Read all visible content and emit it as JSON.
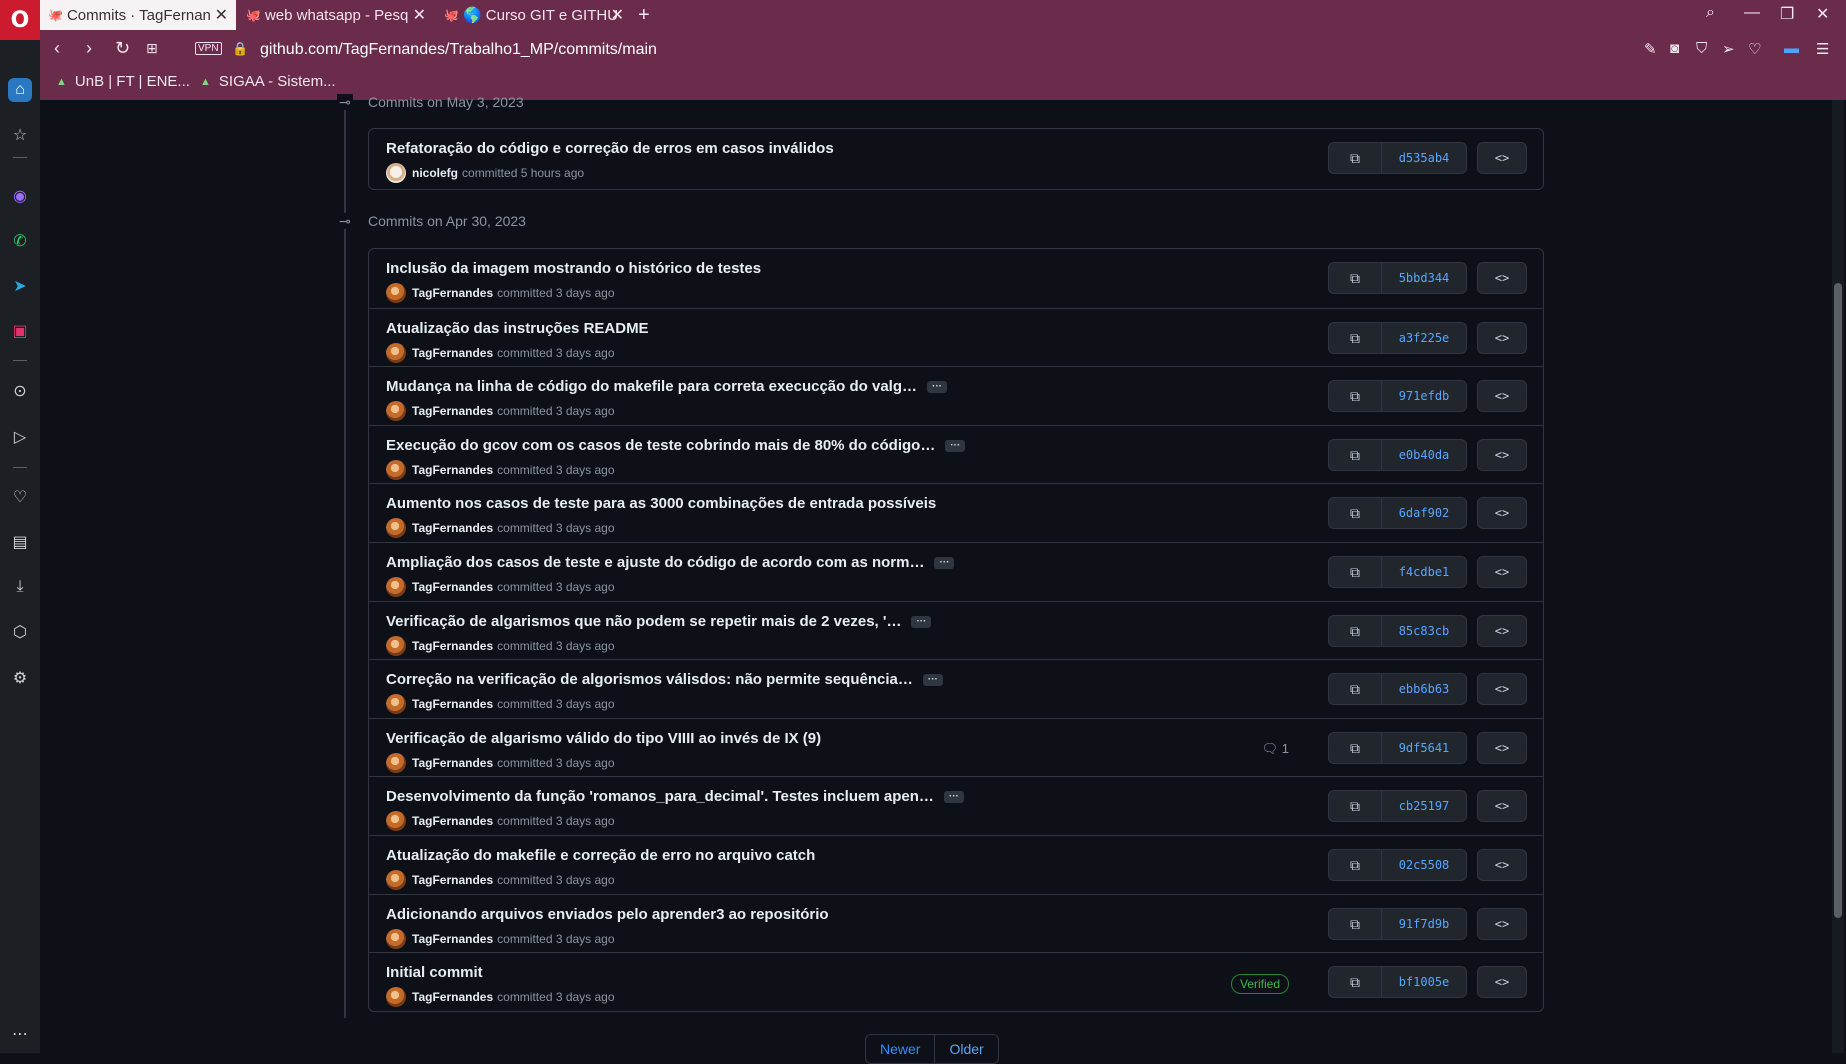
{
  "browser": {
    "tabs": [
      {
        "label": "Commits · TagFernan",
        "icon": "github-icon"
      },
      {
        "label": "web whatsapp - Pesq",
        "icon": "github-icon"
      },
      {
        "label": "🌎 Curso GIT e GITHU",
        "icon": "github-icon"
      }
    ],
    "url": "github.com/TagFernandes/Trabalho1_MP/commits/main",
    "vpn_label": "VPN",
    "bookmarks": [
      {
        "label": "UnB | FT | ENE..."
      },
      {
        "label": "SIGAA - Sistem..."
      }
    ]
  },
  "groups": [
    {
      "date": "Commits on May 3, 2023",
      "commits": [
        {
          "title": "Refatoração do código e correção de erros em casos inválidos",
          "author": "nicolefg",
          "when": "committed 5 hours ago",
          "sha": "d535ab4"
        }
      ]
    },
    {
      "date": "Commits on Apr 30, 2023",
      "commits": [
        {
          "title": "Inclusão da imagem mostrando o histórico de testes",
          "author": "TagFernandes",
          "when": "committed 3 days ago",
          "sha": "5bbd344"
        },
        {
          "title": "Atualização das instruções README",
          "author": "TagFernandes",
          "when": "committed 3 days ago",
          "sha": "a3f225e"
        },
        {
          "title": "Mudança na linha de código do makefile para correta execucção do valg…",
          "ellipsis": "···",
          "author": "TagFernandes",
          "when": "committed 3 days ago",
          "sha": "971efdb"
        },
        {
          "title": "Execução do gcov com os casos de teste cobrindo mais de 80% do código…",
          "ellipsis": "···",
          "author": "TagFernandes",
          "when": "committed 3 days ago",
          "sha": "e0b40da"
        },
        {
          "title": "Aumento nos casos de teste para as 3000 combinações de entrada possíveis",
          "author": "TagFernandes",
          "when": "committed 3 days ago",
          "sha": "6daf902"
        },
        {
          "title": "Ampliação dos casos de teste e ajuste do código de acordo com as norm…",
          "ellipsis": "···",
          "author": "TagFernandes",
          "when": "committed 3 days ago",
          "sha": "f4cdbe1"
        },
        {
          "title": "Verificação de algarismos que não podem se repetir mais de 2 vezes, '…",
          "ellipsis": "···",
          "author": "TagFernandes",
          "when": "committed 3 days ago",
          "sha": "85c83cb"
        },
        {
          "title": "Correção na verificação de algorismos válisdos: não permite sequência…",
          "ellipsis": "···",
          "author": "TagFernandes",
          "when": "committed 3 days ago",
          "sha": "ebb6b63"
        },
        {
          "title": "Verificação de algarismo válido do tipo VIIII ao invés de IX (9)",
          "author": "TagFernandes",
          "when": "committed 3 days ago",
          "sha": "9df5641",
          "comments": "1"
        },
        {
          "title": "Desenvolvimento da função 'romanos_para_decimal'. Testes incluem apen…",
          "ellipsis": "···",
          "author": "TagFernandes",
          "when": "committed 3 days ago",
          "sha": "cb25197"
        },
        {
          "title": "Atualização do makefile e correção de erro no arquivo catch",
          "author": "TagFernandes",
          "when": "committed 3 days ago",
          "sha": "02c5508"
        },
        {
          "title": "Adicionando arquivos enviados pelo aprender3 ao repositório",
          "author": "TagFernandes",
          "when": "committed 3 days ago",
          "sha": "91f7d9b"
        },
        {
          "title": "Initial commit",
          "author": "TagFernandes",
          "when": "committed 3 days ago",
          "sha": "bf1005e",
          "badge": "Verified"
        }
      ]
    }
  ],
  "pagination": {
    "newer": "Newer",
    "older": "Older"
  }
}
